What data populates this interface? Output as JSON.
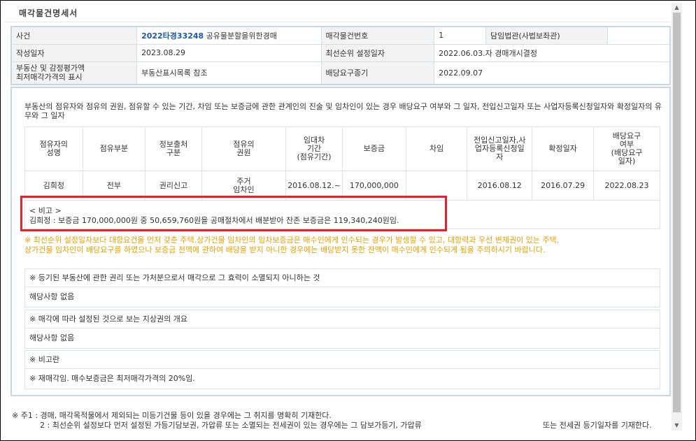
{
  "page_title": "매각물건명세서",
  "info": {
    "case_label": "사건",
    "case_number": "2022타경33248",
    "case_name": "공유물분할을위한경매",
    "item_no_label": "매각물건번호",
    "item_no": "1",
    "judge_label": "담임법관(사법보좌관)",
    "judge_value": "",
    "written_date_label": "작성일자",
    "written_date": "2023.08.29",
    "first_right_label": "최선순위 설정일자",
    "first_right_value": "2022.06.03.자 경매개시결정",
    "appraisal_label_1": "부동산 및 감정평가액",
    "appraisal_label_2": "최저매각가격의 표시",
    "appraisal_value": "부동산표시목록 참조",
    "dividend_deadline_label": "배당요구종기",
    "dividend_deadline": "2022.09.07"
  },
  "intro_text": "부동산의 점유자와 점유의 권원, 점유할 수 있는 기간, 차임 또는 보증금에 관한 관계인의 진술 및 임차인이 있는 경우 배당요구 여부와 그 일자, 전입신고일자 또는 사업자등록신청일자와 확정일자의 유무와 그 일자",
  "occupancy_headers": [
    [
      "점유자의",
      "성명"
    ],
    [
      "점유부분"
    ],
    [
      "정보출처",
      "구분"
    ],
    [
      "점유의",
      "권원"
    ],
    [
      "임대차",
      "기간",
      "(점유기간)"
    ],
    [
      "보증금"
    ],
    [
      "차임"
    ],
    [
      "전입신고일자,사",
      "업자등록신청일",
      "자"
    ],
    [
      "확정일자"
    ],
    [
      "배당요구",
      "여부",
      "(배당요구",
      "일자)"
    ]
  ],
  "occupancy_row": {
    "name": "김희정",
    "part": "전부",
    "source": "권리신고",
    "title_1": "주거",
    "title_2": "임차인",
    "period": "2016.08.12.~",
    "deposit": "170,000,000",
    "rent": "",
    "move_in_date": "2016.08.12",
    "fixed_date": "2016.07.29",
    "dividend_request": "2022.08.23"
  },
  "remark": {
    "title": "< 비고 >",
    "text": "김희정 : 보증금 170,000,000원 중 50,659,760원을 공매절차에서 배분받아 잔존 보증금은 119,340,240원임."
  },
  "warning_text_1": "※ 최선순위 설정일자보다 대항요건을 먼저 갖춘 주택.상가건물 임차인의 임차보증금은 매수인에게 인수되는 경우가 발생할 수 있고, 대항력과 우선 변제권이 있는 주택,",
  "warning_text_2": "상가건물 임차인이 배당요구를 하였으나 보증금 전액에 관하여 배당을 받지 아니한 경우에는 배당받지 못한 잔액이 매수인에게 인수되게 됨을 주의하시기 바랍니다.",
  "registered_rights": {
    "title": "※ 등기된 부동산에 관한 권리 또는 가처분으로서 매각으로 그 효력이 소멸되지 아니하는 것",
    "body": "해당사항 없음"
  },
  "surface_rights": {
    "title": "※ 매각에 따라 설정된 것으로 보는 지상권의 개요",
    "body": "해당사항 없음"
  },
  "notes": {
    "title": "※ 비고란",
    "body": "※ 재매각임. 매수보증금은 최저매각가격의 20%임."
  },
  "footnote_1": "※ 주1 : 경매, 매각목적물에서 제외되는 미등기건물 등이 있을 경우에는 그 취지를 명확히 기재한다.",
  "footnote_2a": "2 : 최선순위 설정보다 먼저 설정된 가등기담보권, 가압류 또는 소멸되는 전세권이 있는 경우에는 그 담보가등기, 가압류",
  "footnote_2b": "또는 전세권 등기일자를 기재한다.",
  "colors": {
    "highlight_border": "#e5212b",
    "warning_text": "#e6a000",
    "case_number": "#1c5aa8",
    "table_border": "#c7d5e4"
  }
}
